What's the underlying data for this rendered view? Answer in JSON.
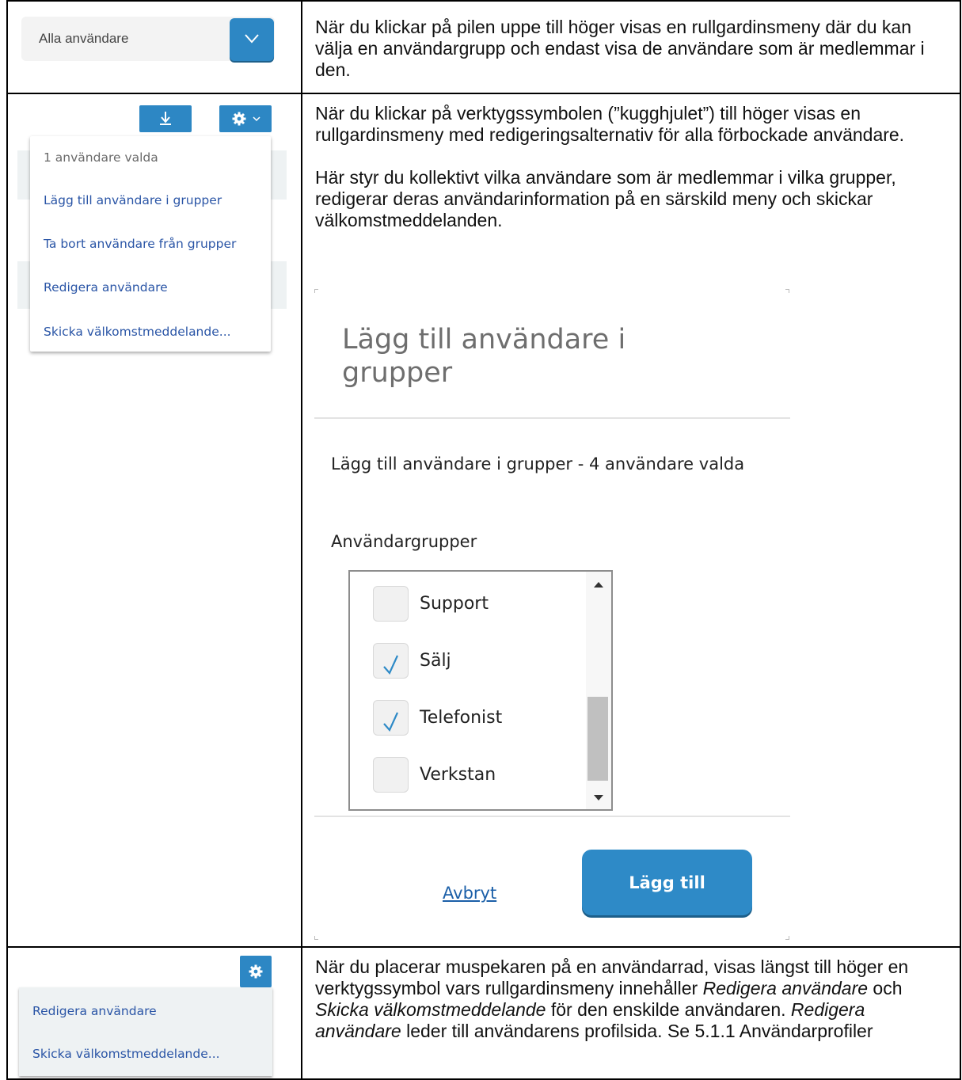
{
  "row1": {
    "filter_label": "Alla användare",
    "dropdown_icon": "chevron-down-icon",
    "description": "När du klickar på pilen uppe till höger visas en rullgardinsmeny där du kan välja en användargrupp och endast visa de användare som är medlemmar i den."
  },
  "row2": {
    "download_icon": "download-icon",
    "gear_icon": "gear-icon",
    "menu": {
      "header": "1 användare valda",
      "items": [
        "Lägg till användare i grupper",
        "Ta bort användare från grupper",
        "Redigera användare",
        "Skicka välkomstmeddelande..."
      ]
    },
    "description_p1": "När du klickar på verktygssymbolen (”kugghjulet”) till höger visas en rullgardinsmeny med redigeringsalternativ för alla förbockade användare.",
    "description_p2": "Här styr du kollektivt vilka användare som är medlemmar i vilka grupper, redigerar deras användarinformation på en särskild meny och skickar välkomstmeddelanden."
  },
  "dialog": {
    "title": "Lägg till användare i grupper",
    "subtitle": "Lägg till användare i grupper - 4 användare valda",
    "groups_label": "Användargrupper",
    "groups": [
      {
        "label": "Support",
        "checked": false
      },
      {
        "label": "Sälj",
        "checked": true
      },
      {
        "label": "Telefonist",
        "checked": true
      },
      {
        "label": "Verkstan",
        "checked": false
      }
    ],
    "cancel_label": "Avbryt",
    "add_label": "Lägg till"
  },
  "row3": {
    "gear_icon": "gear-icon",
    "menu_items": [
      "Redigera användare",
      "Skicka välkomstmeddelande..."
    ],
    "description": {
      "t1": "När du placerar muspekaren på en användarrad, visas längst till höger en verktygssymbol vars rullgardinsmeny innehåller ",
      "i1": "Redigera användare",
      "t2": " och ",
      "i2": "Skicka välkomstmeddelande",
      "t3": " för den enskilde användaren. ",
      "i3": "Redigera användare",
      "t4": " leder till användarens profilsida. Se 5.1.1 Användarprofiler"
    }
  }
}
